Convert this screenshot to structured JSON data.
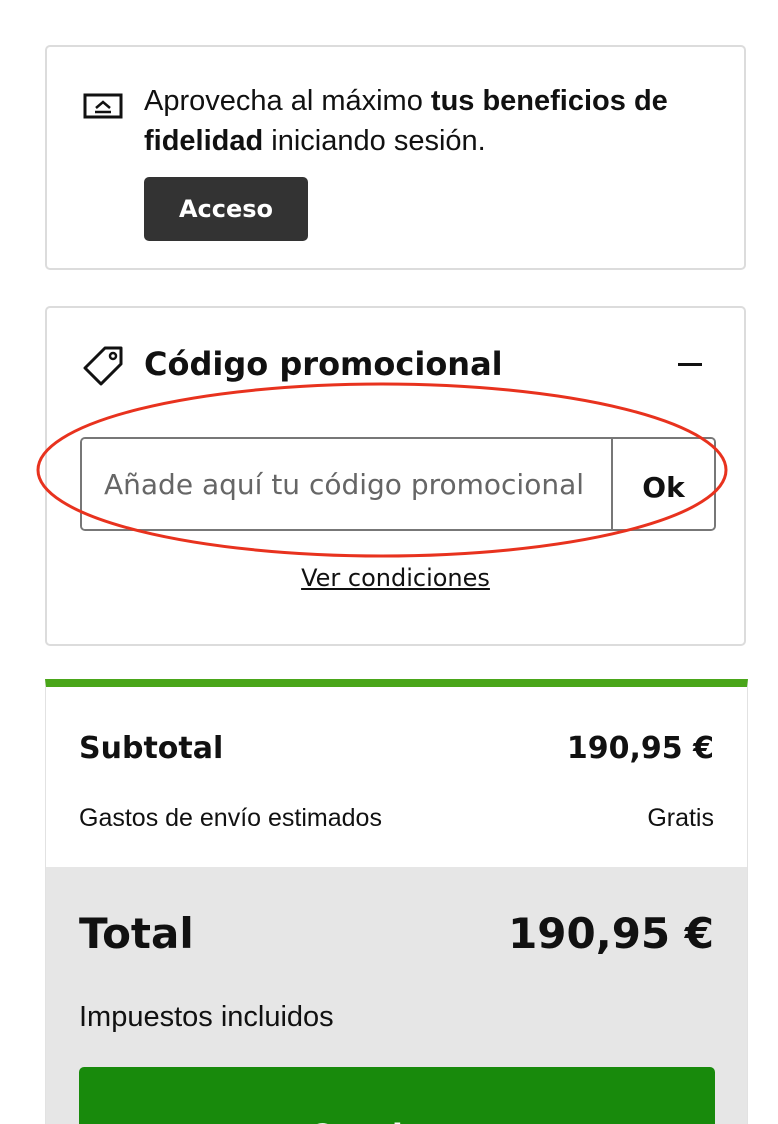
{
  "loyalty": {
    "text_before": "Aprovecha al máximo ",
    "text_bold": "tus beneficios de fidelidad",
    "text_after": " iniciando sesión.",
    "login_label": "Acceso",
    "icon": "login-arrow-icon"
  },
  "promo": {
    "title": "Código promocional",
    "icon": "tag-icon",
    "collapse_icon": "minus-icon",
    "placeholder": "Añade aquí tu código promocional",
    "value": "",
    "ok_label": "Ok",
    "conditions_label": "Ver condiciones"
  },
  "summary": {
    "subtotal_label": "Subtotal",
    "subtotal_value": "190,95 €",
    "shipping_label": "Gastos de envío estimados",
    "shipping_value": "Gratis",
    "total_label": "Total",
    "total_value": "190,95 €",
    "tax_note": "Impuestos incluidos",
    "continue_label": "Continuar"
  },
  "colors": {
    "accent_green": "#4aa61a",
    "button_green": "#188a0c",
    "dark_button": "#333333",
    "highlight_red": "#e8321e"
  }
}
